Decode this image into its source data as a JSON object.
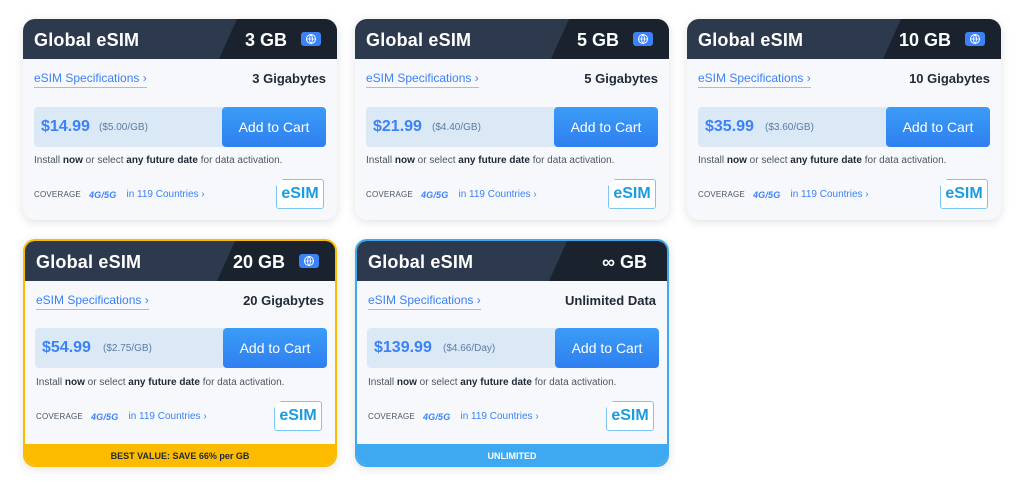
{
  "common": {
    "plan_name": "Global eSIM",
    "spec_link": "eSIM Specifications ›",
    "cart_label": "Add to Cart",
    "install_pre": "Install ",
    "install_now": "now",
    "install_mid": " or select ",
    "install_future": "any future date",
    "install_post": " for data activation.",
    "coverage_label": "COVERAGE",
    "network": "4G/5G",
    "countries": "in 119 Countries ›",
    "esim_badge": "eSIM",
    "globe_icon": "globe-icon"
  },
  "cards": [
    {
      "size": "3 GB",
      "spec": "3 Gigabytes",
      "price": "$14.99",
      "per": "($5.00/GB)",
      "footer": ""
    },
    {
      "size": "5 GB",
      "spec": "5 Gigabytes",
      "price": "$21.99",
      "per": "($4.40/GB)",
      "footer": ""
    },
    {
      "size": "10 GB",
      "spec": "10 Gigabytes",
      "price": "$35.99",
      "per": "($3.60/GB)",
      "footer": ""
    },
    {
      "size": "20 GB",
      "spec": "20 Gigabytes",
      "price": "$54.99",
      "per": "($2.75/GB)",
      "footer": "BEST VALUE: SAVE 66% per GB"
    },
    {
      "size": "∞ GB",
      "spec": "Unlimited Data",
      "price": "$139.99",
      "per": "($4.66/Day)",
      "footer": "UNLIMITED"
    }
  ],
  "colors": {
    "accent": "#3b82f6",
    "header": "#2d3a4d",
    "best_value": "#fdbb00",
    "unlimited": "#3ea8f0"
  }
}
